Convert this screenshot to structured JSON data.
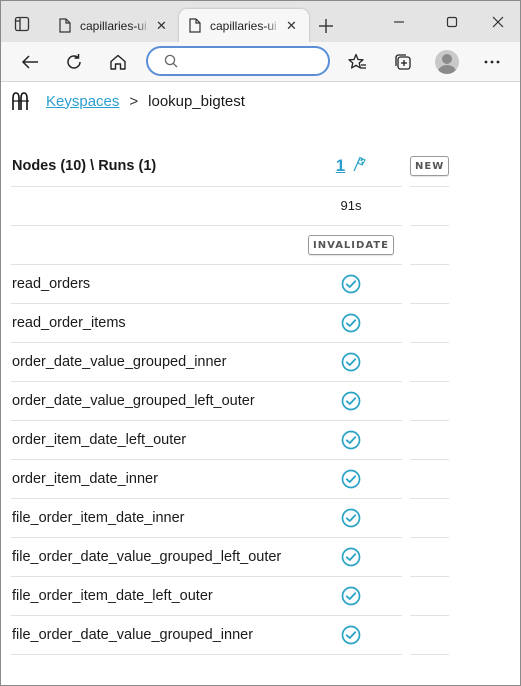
{
  "browser": {
    "tabs": [
      {
        "title": "capillaries-ui",
        "close": "✕",
        "active": false
      },
      {
        "title": "capillaries-ui",
        "close": "✕",
        "active": true
      }
    ],
    "address": {
      "value": "",
      "placeholder": ""
    },
    "accent_color": "#5a8fd8"
  },
  "breadcrumb": {
    "link_label": "Keyspaces",
    "separator": ">",
    "current": "lookup_bigtest"
  },
  "table": {
    "header_title": "Nodes (10) \\ Runs (1)",
    "run_number": "1",
    "new_button": "NEW",
    "duration": "91s",
    "invalidate_button": "INVALIDATE",
    "status_color": "#2aa3c6",
    "nodes": [
      {
        "name": "read_orders",
        "status": "complete"
      },
      {
        "name": "read_order_items",
        "status": "complete"
      },
      {
        "name": "order_date_value_grouped_inner",
        "status": "complete"
      },
      {
        "name": "order_date_value_grouped_left_outer",
        "status": "complete"
      },
      {
        "name": "order_item_date_left_outer",
        "status": "complete"
      },
      {
        "name": "order_item_date_inner",
        "status": "complete"
      },
      {
        "name": "file_order_item_date_inner",
        "status": "complete"
      },
      {
        "name": "file_order_date_value_grouped_left_outer",
        "status": "complete"
      },
      {
        "name": "file_order_item_date_left_outer",
        "status": "complete"
      },
      {
        "name": "file_order_date_value_grouped_inner",
        "status": "complete"
      }
    ]
  }
}
